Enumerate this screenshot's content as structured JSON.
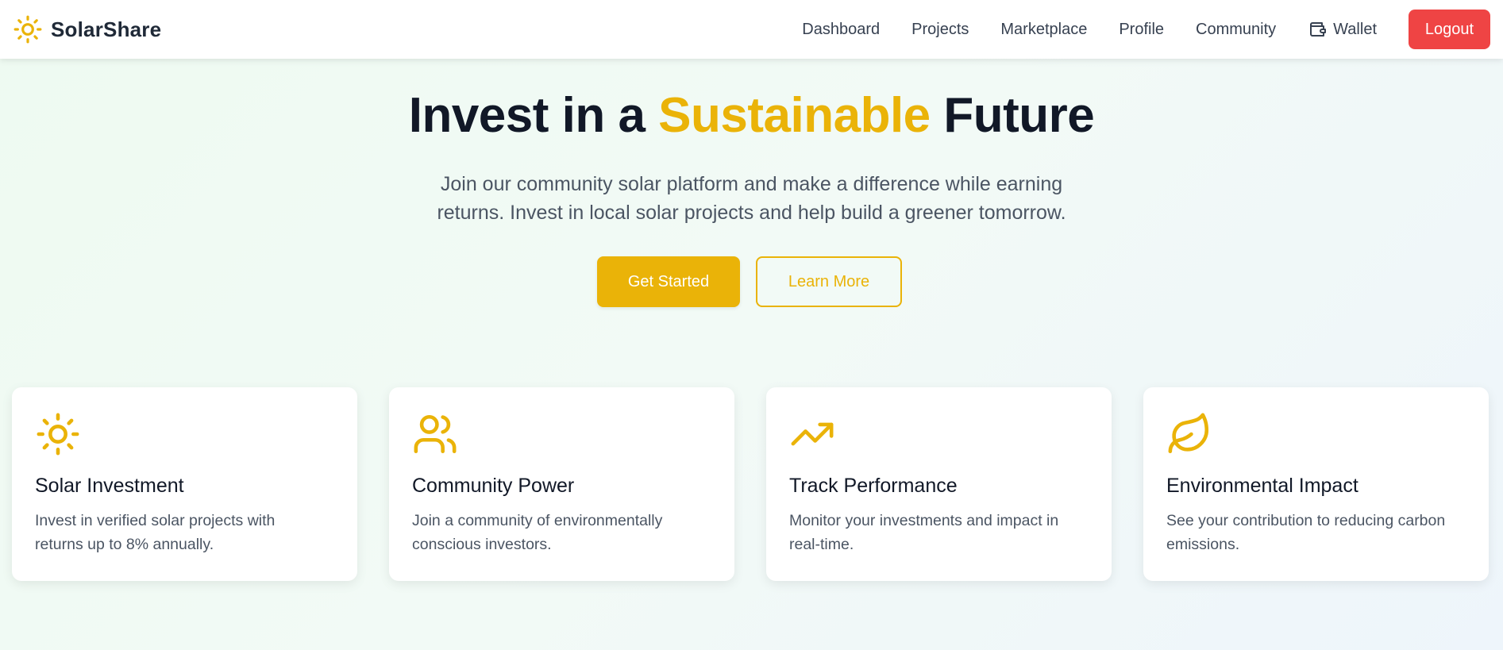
{
  "brand": {
    "name": "SolarShare",
    "icon": "sun-icon"
  },
  "nav": {
    "links": [
      {
        "label": "Dashboard"
      },
      {
        "label": "Projects"
      },
      {
        "label": "Marketplace"
      },
      {
        "label": "Profile"
      },
      {
        "label": "Community"
      },
      {
        "label": "Wallet",
        "icon": "wallet-icon"
      }
    ],
    "logout_label": "Logout"
  },
  "hero": {
    "title_before": "Invest in a ",
    "title_accent": "Sustainable",
    "title_after": " Future",
    "subtitle_line1": "Join our community solar platform and make a difference while earning",
    "subtitle_line2": "returns. Invest in local solar projects and help build a greener tomorrow.",
    "primary_cta": "Get Started",
    "secondary_cta": "Learn More"
  },
  "features": [
    {
      "icon": "sun-icon",
      "title": "Solar Investment",
      "desc_line1": "Invest in verified solar projects with",
      "desc_line2": "returns up to 8% annually."
    },
    {
      "icon": "users-icon",
      "title": "Community Power",
      "desc_line1": "Join a community of environmentally",
      "desc_line2": "conscious investors."
    },
    {
      "icon": "trending-up-icon",
      "title": "Track Performance",
      "desc_line1": "Monitor your investments and impact in",
      "desc_line2": "real-time."
    },
    {
      "icon": "leaf-icon",
      "title": "Environmental Impact",
      "desc_line1": "See your contribution to reducing carbon",
      "desc_line2": "emissions."
    }
  ],
  "colors": {
    "accent": "#eab308",
    "logout": "#ef4444",
    "heading": "#111827",
    "body_text": "#4b5563"
  }
}
